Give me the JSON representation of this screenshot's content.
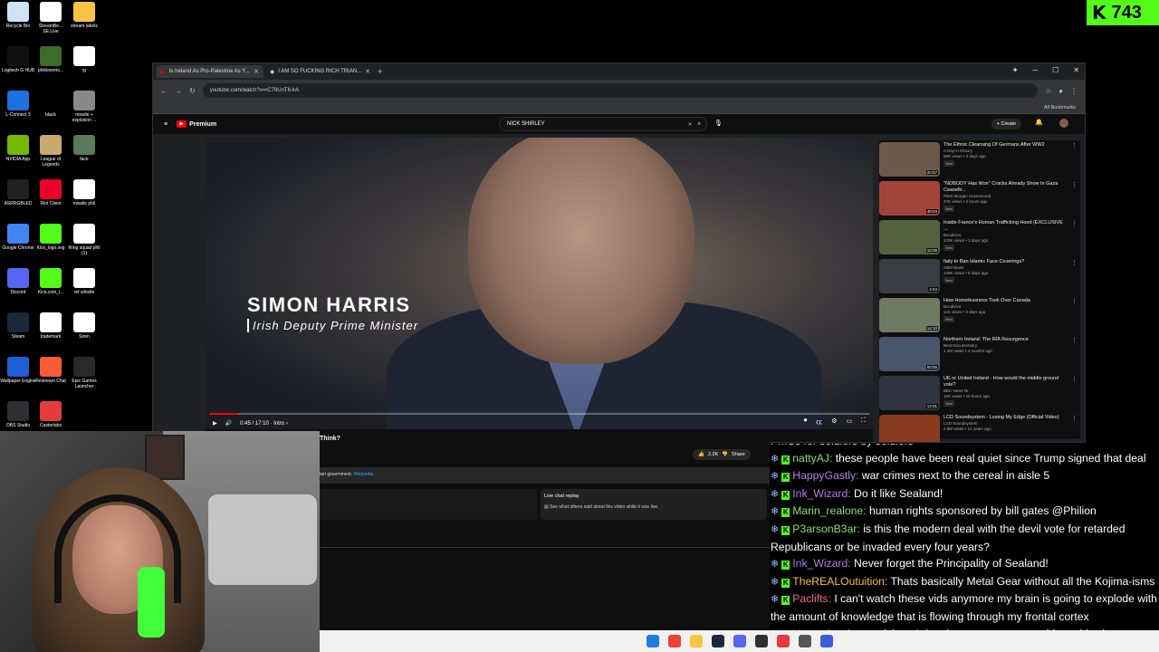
{
  "desktop": {
    "icons": [
      {
        "label": "Recycle Bin",
        "icon": "recycle-bin-icon",
        "color": "#cfe3f5"
      },
      {
        "label": "StreamBe... SE.Live",
        "icon": "streamelements-icon",
        "color": "#ffffff"
      },
      {
        "label": "stream labels",
        "icon": "folder-icon",
        "color": "#f5c542"
      },
      {
        "label": "Logitech G HUB",
        "icon": "logitech-icon",
        "color": "#111111"
      },
      {
        "label": "philionemo...",
        "icon": "image-icon",
        "color": "#3d6b2b"
      },
      {
        "label": "ig",
        "icon": "file-icon",
        "color": "#ffffff"
      },
      {
        "label": "L-Connect 3",
        "icon": "lconnect-icon",
        "color": "#1e6fe0"
      },
      {
        "label": "black",
        "icon": "file-icon",
        "color": "#000000"
      },
      {
        "label": "missile + explosion ...",
        "icon": "image-icon",
        "color": "#888888"
      },
      {
        "label": "NVIDIA App",
        "icon": "nvidia-icon",
        "color": "#76b900"
      },
      {
        "label": "League of Legends",
        "icon": "league-icon",
        "color": "#c8aa6e"
      },
      {
        "label": "face",
        "icon": "image-icon",
        "color": "#5b7a5b"
      },
      {
        "label": "ASRRGBLED",
        "icon": "asrock-icon",
        "color": "#222222"
      },
      {
        "label": "Riot Client",
        "icon": "riot-icon",
        "color": "#eb0029"
      },
      {
        "label": "missile phil",
        "icon": "video-file-icon",
        "color": "#ffffff"
      },
      {
        "label": "Google Chrome",
        "icon": "chrome-icon",
        "color": "#4285f4"
      },
      {
        "label": "Kick_logo.svg",
        "icon": "kick-icon",
        "color": "#53fc18"
      },
      {
        "label": "firing squad phil (1)",
        "icon": "video-file-icon",
        "color": "#ffffff"
      },
      {
        "label": "Discord",
        "icon": "discord-icon",
        "color": "#5865f2"
      },
      {
        "label": "Kick.com_l...",
        "icon": "kick-icon",
        "color": "#53fc18"
      },
      {
        "label": "ref whistle",
        "icon": "video-file-icon",
        "color": "#ffffff"
      },
      {
        "label": "Steam",
        "icon": "steam-icon",
        "color": "#1b2838"
      },
      {
        "label": "trademark",
        "icon": "trademark-icon",
        "color": "#ffffff"
      },
      {
        "label": "Siren",
        "icon": "video-file-icon",
        "color": "#ffffff"
      },
      {
        "label": "Wallpaper Engine",
        "icon": "wallpaper-engine-icon",
        "color": "#1e5fd9"
      },
      {
        "label": "Restream Chat",
        "icon": "restream-icon",
        "color": "#ff5a36"
      },
      {
        "label": "Epic Games Launcher",
        "icon": "epic-icon",
        "color": "#2a2a2a"
      },
      {
        "label": "OBS Studio",
        "icon": "obs-icon",
        "color": "#302e31"
      },
      {
        "label": "Casterlabs",
        "icon": "casterlabs-icon",
        "color": "#e53b3b"
      }
    ]
  },
  "kick_counter": {
    "value": "743"
  },
  "browser": {
    "tabs": [
      {
        "title": "Is Ireland As Pro-Palestine As Y...",
        "active": true
      },
      {
        "title": "I AM SO FUCKING RICH TRIAN...",
        "active": false
      }
    ],
    "new_tab": "+",
    "url": "youtube.com/watch?v=rC79UnT6-kA",
    "bookmarks_label": "All Bookmarks"
  },
  "youtube": {
    "logo_text": "Premium",
    "search_value": "NICK SHIRLEY",
    "create_label": "+ Create",
    "video": {
      "name_caption": "SIMON HARRIS",
      "role_caption": "Irish Deputy Prime Minister",
      "time": "0:45 / 17:10 · Intro ›",
      "progress": 0.044
    },
    "below": {
      "title_fragment": "Think?",
      "likes": "2.2K",
      "share": "Share",
      "desc_text": "tari government.",
      "desc_link": "Wikipedia",
      "replay_title": "Live chat replay",
      "replay_sub": "See what others said about this video while it was live."
    },
    "recommendations": [
      {
        "title": "The Ethnic Cleansing Of Germans After WW2",
        "channel": "A Day in History",
        "meta": "69K views • 3 days ago",
        "badge": "New",
        "duration": "20:57",
        "color": "#6b5a4a"
      },
      {
        "title": "\"NOBODY Has Won\" Cracks Already Show In Gaza Ceasefir...",
        "channel": "Piers Morgan Uncensored",
        "meta": "27K views • 2 hours ago",
        "badge": "New",
        "duration": "48:04",
        "color": "#a3443a"
      },
      {
        "title": "Inside France's Human Trafficking Hood (EXCLUSIVE ...",
        "channel": "Bocalvivo",
        "meta": "133K views • 3 days ago",
        "badge": "New",
        "duration": "18:06",
        "color": "#55603f"
      },
      {
        "title": "Italy to Ban Islamic Face Coverings?",
        "channel": "GBN News",
        "meta": "229K views • 6 days ago",
        "badge": "New",
        "duration": "4:04",
        "color": "#3b3b44"
      },
      {
        "title": "How Homelessness Took Over Canada",
        "channel": "Bocalvivo",
        "meta": "11K views • 3 days ago",
        "badge": "New",
        "duration": "14:10",
        "color": "#6f7a62"
      },
      {
        "title": "Northern Ireland: The IRA Resurgence",
        "channel": "Best Documentary",
        "meta": "1.4M views • 4 months ago",
        "badge": "",
        "duration": "50:05",
        "color": "#48556a"
      },
      {
        "title": "UK or United Ireland - How would the middle ground vote?",
        "channel": "BBC News NI",
        "meta": "16K views • 15 hours ago",
        "badge": "New",
        "duration": "13:31",
        "color": "#2f3440"
      },
      {
        "title": "LCD Soundsystem - Losing My Edge (Official Video)",
        "channel": "LCD Soundsystem",
        "meta": "2.9M views • 13 years ago",
        "badge": "",
        "duration": "4:28",
        "color": "#8a3c20"
      }
    ]
  },
  "chat": {
    "messages": [
      {
        "user": "",
        "color": "#ffffff",
        "text": "PMCs for soldiers by soldiers",
        "top": true
      },
      {
        "user": "nattyAJ:",
        "color": "#8ee06b",
        "text": " these people have been real quiet since Trump signed that deal"
      },
      {
        "user": "HappyGastly:",
        "color": "#b57be8",
        "text": " war crimes next to the cereal in aisle 5"
      },
      {
        "user": "Ink_Wizard:",
        "color": "#b57be8",
        "text": " Do it like Sealand!"
      },
      {
        "user": "Marin_realone:",
        "color": "#8ee06b",
        "text": " human rights sponsored by bill gates @Philion"
      },
      {
        "user": "P3arsonB3ar:",
        "color": "#8ee06b",
        "text": " is this the modern deal with the devil vote for retarded Republicans or be invaded every four years?"
      },
      {
        "user": "Ink_Wizard:",
        "color": "#b57be8",
        "text": " Never forget the Principality of Sealand!"
      },
      {
        "user": "TheREALOutuition:",
        "color": "#f0c23c",
        "text": " Thats basically Metal Gear without all the Kojima-isms"
      },
      {
        "user": "Paclifts:",
        "color": "#f06a8f",
        "text": " I can't watch these vids anymore my brain is going to explode with the amount of knowledge that is flowing through my frontal cortex"
      },
      {
        "user": "HappyGastly:",
        "color": "#b57be8",
        "text": " get rich so I dont have to ever go outside to this chaos"
      }
    ]
  },
  "taskbar": {
    "icons": [
      {
        "name": "windows-start-icon",
        "color": "#1e7be0"
      },
      {
        "name": "chrome-icon",
        "color": "#ea4335"
      },
      {
        "name": "file-explorer-icon",
        "color": "#f5c542"
      },
      {
        "name": "steam-icon",
        "color": "#1b2838"
      },
      {
        "name": "discord-icon",
        "color": "#5865f2"
      },
      {
        "name": "obs-icon",
        "color": "#302e31"
      },
      {
        "name": "restream-icon",
        "color": "#e53b3b"
      },
      {
        "name": "app-icon",
        "color": "#555555"
      },
      {
        "name": "chat-app-icon",
        "color": "#3b5bdb"
      }
    ]
  }
}
